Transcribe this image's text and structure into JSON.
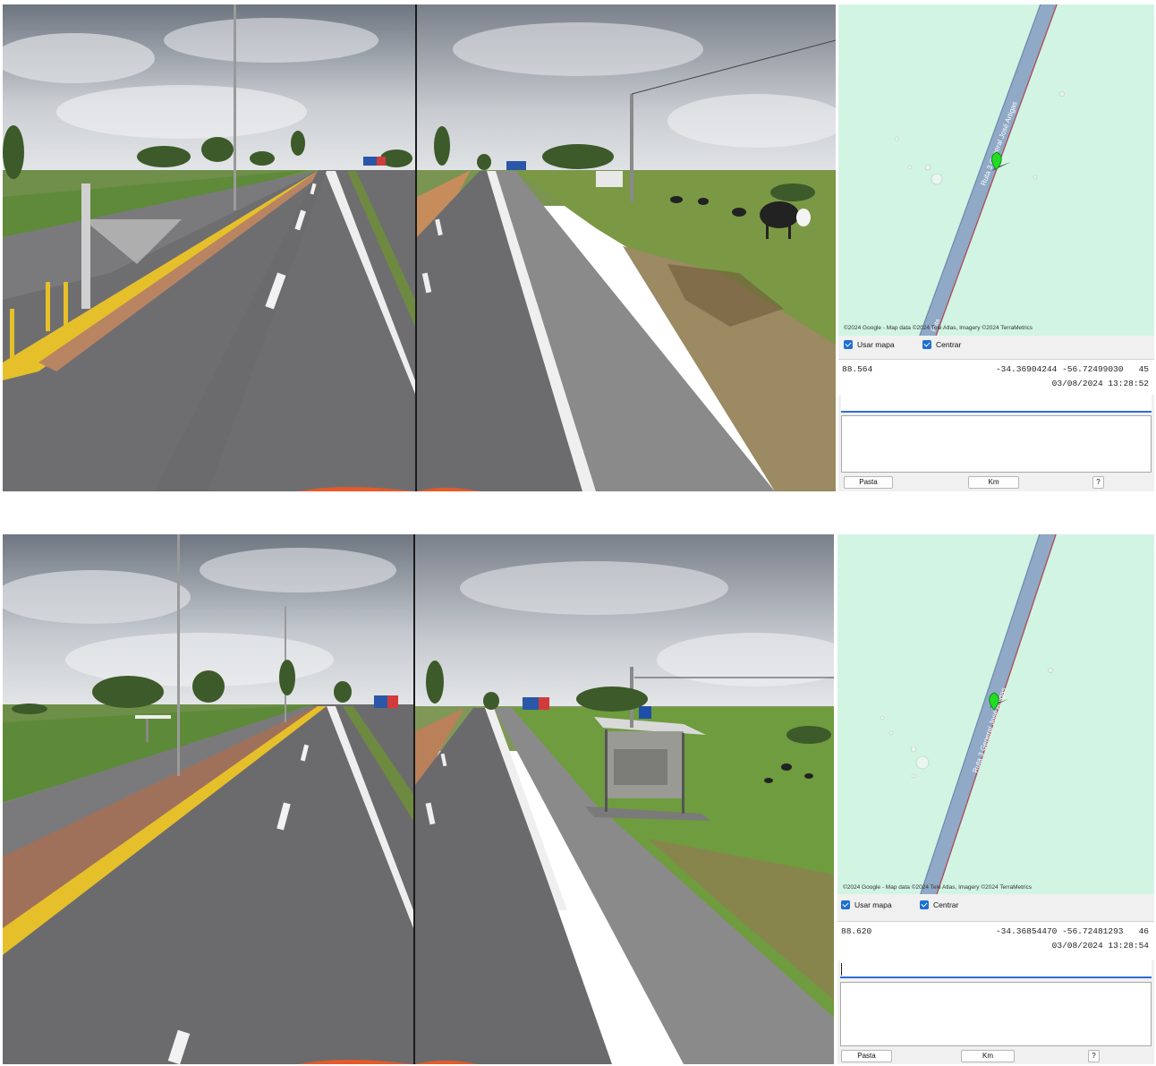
{
  "frames": [
    {
      "map": {
        "road_label": "Ruta 3 General José Artigas",
        "road_label_bottom": "Ruta",
        "attribution": "©2024 Google - Map data ©2024 Tele Atlas, Imagery ©2024 TerraMetrics",
        "marker_icon": "location-pin-icon"
      },
      "options": {
        "usar_mapa": "Usar mapa",
        "centrar": "Centrar"
      },
      "readout": {
        "km": "88.564",
        "latitude": "-34.36904244",
        "longitude": "-56.72499030",
        "speed": "45",
        "timestamp": "03/08/2024 13:28:52"
      },
      "buttons": {
        "pasta": "Pasta",
        "km": "Km",
        "help": "?"
      }
    },
    {
      "map": {
        "road_label": "Ruta 3 General José Artigas",
        "road_label_bottom": "",
        "attribution": "©2024 Google - Map data ©2024 Tele Atlas, Imagery ©2024 TerraMetrics",
        "marker_icon": "location-pin-icon"
      },
      "options": {
        "usar_mapa": "Usar mapa",
        "centrar": "Centrar"
      },
      "readout": {
        "km": "88.620",
        "latitude": "-34.36854470",
        "longitude": "-56.72481293",
        "speed": "46",
        "timestamp": "03/08/2024 13:28:54"
      },
      "buttons": {
        "pasta": "Pasta",
        "km": "Km",
        "help": "?"
      }
    }
  ],
  "colors": {
    "map_background": "#d2f5e3",
    "road_fill": "#8fa9c6",
    "marker": "#22dd22",
    "checkbox": "#1e6fd0",
    "entry_underline": "#2f6fd6"
  }
}
